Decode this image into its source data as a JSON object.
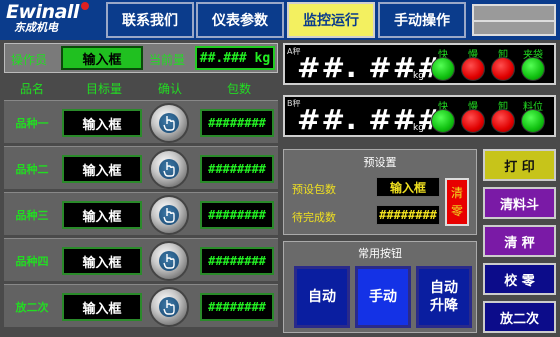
{
  "header": {
    "logo_text": "Ewinall",
    "logo_sub": "东成机电",
    "nav": [
      {
        "label": "联系我们",
        "active": false
      },
      {
        "label": "仪表参数",
        "active": false
      },
      {
        "label": "监控运行",
        "active": true
      },
      {
        "label": "手动操作",
        "active": false
      }
    ]
  },
  "operator": {
    "label": "操作员",
    "input": "输入框",
    "current_label": "当前量",
    "current_value": "##.### kg"
  },
  "table": {
    "headers": [
      "品名",
      "目标量",
      "确认",
      "包数"
    ],
    "rows": [
      {
        "name": "品种一",
        "target": "输入框",
        "count": "########"
      },
      {
        "name": "品种二",
        "target": "输入框",
        "count": "########"
      },
      {
        "name": "品种三",
        "target": "输入框",
        "count": "########"
      },
      {
        "name": "品种四",
        "target": "输入框",
        "count": "########"
      },
      {
        "name": "放二次",
        "target": "输入框",
        "count": "########"
      }
    ]
  },
  "scales": [
    {
      "tag": "A秤",
      "value": "##. ###",
      "unit": "kg",
      "indicators": [
        {
          "label": "快",
          "color": "green"
        },
        {
          "label": "慢",
          "color": "red"
        },
        {
          "label": "卸",
          "color": "red"
        },
        {
          "label": "夹袋",
          "color": "green"
        }
      ]
    },
    {
      "tag": "B秤",
      "value": "##. ###",
      "unit": "kg",
      "indicators": [
        {
          "label": "快",
          "color": "green"
        },
        {
          "label": "慢",
          "color": "red"
        },
        {
          "label": "卸",
          "color": "red"
        },
        {
          "label": "料位",
          "color": "green"
        }
      ]
    }
  ],
  "preset": {
    "title": "预设置",
    "preset_label": "预设包数",
    "preset_value": "输入框",
    "pending_label": "待完成数",
    "pending_value": "########",
    "clear": "清零"
  },
  "common": {
    "title": "常用按钮",
    "auto": "自动",
    "manual": "手动",
    "auto_lift": "自动升降"
  },
  "side_buttons": {
    "print": "打  印",
    "clear_bucket": "清料斗",
    "clear_scale": "清  秤",
    "calibrate": "校  零",
    "release_twice": "放二次"
  },
  "colors": {
    "header_bg": "#0b3c8c",
    "active_tab": "#f3f060",
    "green_text": "#22dd22",
    "yellow_text": "#f0e020",
    "lamp_green": "#10c010",
    "lamp_red": "#e00000"
  }
}
